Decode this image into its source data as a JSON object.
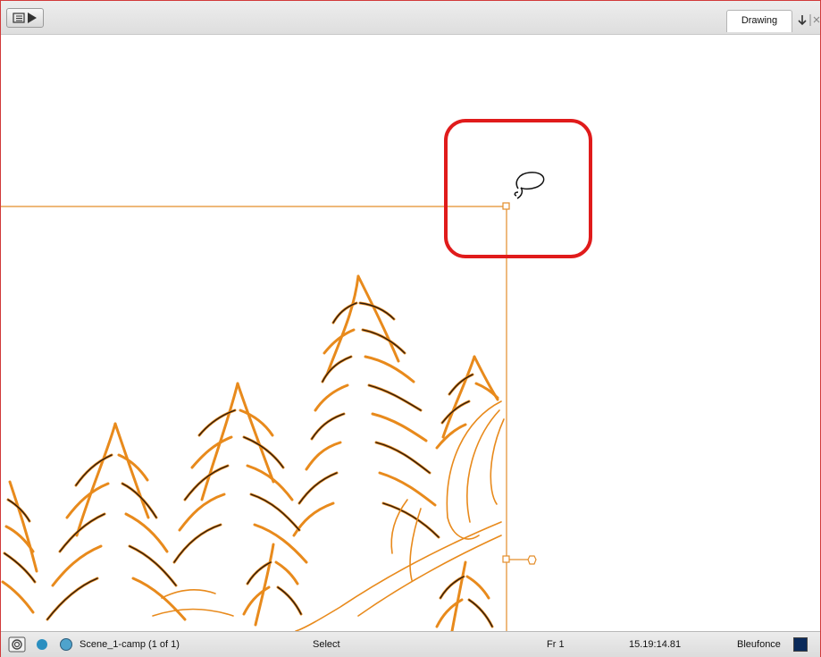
{
  "app": {
    "tab_label": "Drawing",
    "colors": {
      "frame_border": "#d13a3a",
      "guide_line": "#e38d2a",
      "highlight": "#e01b1b",
      "swatch": "#0a2a5a",
      "dot_blue": "#2b8fc0",
      "dot_blue2": "#4ea3cc"
    }
  },
  "toolbar": {
    "menu_icon": "menu-play-icon",
    "tab_controls_icon": "arrow-close-icon"
  },
  "canvas": {
    "content": "orange tree drawing with selection bounding box and lasso cursor"
  },
  "statusbar": {
    "scene_label": "Scene_1-camp (1 of 1)",
    "tool_label": "Select",
    "frame_label": "Fr 1",
    "timecode": "15.19:14.81",
    "color_name": "Bleufonce"
  }
}
